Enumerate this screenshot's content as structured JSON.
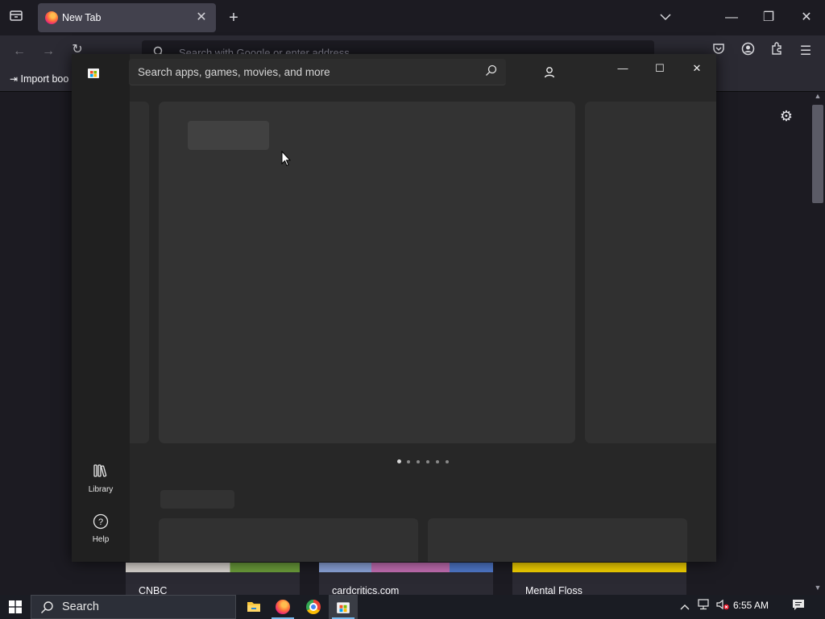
{
  "browser": {
    "tab_title": "New Tab",
    "tab_close": "✕",
    "new_tab": "+",
    "url_placeholder": "Search with Google or enter address",
    "bookmark_import": "Import boo",
    "window_controls": {
      "minimize": "—",
      "restore": "❐",
      "close": "✕"
    }
  },
  "new_tab_page": {
    "shortcuts": [
      {
        "label": "CNBC",
        "color": "#6a9b3a"
      },
      {
        "label": "cardcritics.com",
        "color": "#c26db2"
      },
      {
        "label": "Mental Floss",
        "color": "#f2d000"
      }
    ]
  },
  "store": {
    "search_placeholder": "Search apps, games, movies, and more",
    "window_controls": {
      "minimize": "—",
      "maximize": "☐",
      "close": "✕"
    },
    "nav": [
      {
        "label": "Library",
        "icon": "library-icon"
      },
      {
        "label": "Help",
        "icon": "help-icon"
      }
    ],
    "carousel_pages": 6,
    "carousel_active": 0
  },
  "taskbar": {
    "search_label": "Search",
    "time": "6:55 AM",
    "pinned": [
      "file-explorer-icon",
      "firefox-icon",
      "chrome-icon",
      "microsoft-store-icon"
    ]
  }
}
